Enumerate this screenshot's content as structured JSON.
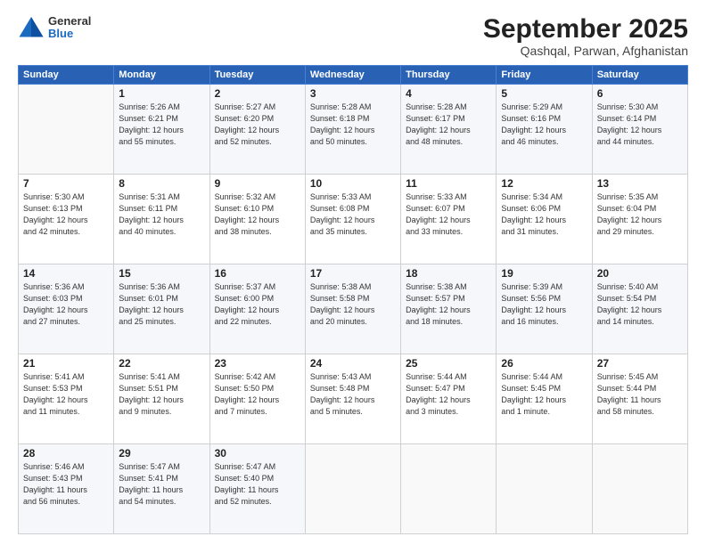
{
  "logo": {
    "general": "General",
    "blue": "Blue"
  },
  "header": {
    "title": "September 2025",
    "subtitle": "Qashqal, Parwan, Afghanistan"
  },
  "weekdays": [
    "Sunday",
    "Monday",
    "Tuesday",
    "Wednesday",
    "Thursday",
    "Friday",
    "Saturday"
  ],
  "weeks": [
    [
      {
        "day": "",
        "info": ""
      },
      {
        "day": "1",
        "info": "Sunrise: 5:26 AM\nSunset: 6:21 PM\nDaylight: 12 hours\nand 55 minutes."
      },
      {
        "day": "2",
        "info": "Sunrise: 5:27 AM\nSunset: 6:20 PM\nDaylight: 12 hours\nand 52 minutes."
      },
      {
        "day": "3",
        "info": "Sunrise: 5:28 AM\nSunset: 6:18 PM\nDaylight: 12 hours\nand 50 minutes."
      },
      {
        "day": "4",
        "info": "Sunrise: 5:28 AM\nSunset: 6:17 PM\nDaylight: 12 hours\nand 48 minutes."
      },
      {
        "day": "5",
        "info": "Sunrise: 5:29 AM\nSunset: 6:16 PM\nDaylight: 12 hours\nand 46 minutes."
      },
      {
        "day": "6",
        "info": "Sunrise: 5:30 AM\nSunset: 6:14 PM\nDaylight: 12 hours\nand 44 minutes."
      }
    ],
    [
      {
        "day": "7",
        "info": "Sunrise: 5:30 AM\nSunset: 6:13 PM\nDaylight: 12 hours\nand 42 minutes."
      },
      {
        "day": "8",
        "info": "Sunrise: 5:31 AM\nSunset: 6:11 PM\nDaylight: 12 hours\nand 40 minutes."
      },
      {
        "day": "9",
        "info": "Sunrise: 5:32 AM\nSunset: 6:10 PM\nDaylight: 12 hours\nand 38 minutes."
      },
      {
        "day": "10",
        "info": "Sunrise: 5:33 AM\nSunset: 6:08 PM\nDaylight: 12 hours\nand 35 minutes."
      },
      {
        "day": "11",
        "info": "Sunrise: 5:33 AM\nSunset: 6:07 PM\nDaylight: 12 hours\nand 33 minutes."
      },
      {
        "day": "12",
        "info": "Sunrise: 5:34 AM\nSunset: 6:06 PM\nDaylight: 12 hours\nand 31 minutes."
      },
      {
        "day": "13",
        "info": "Sunrise: 5:35 AM\nSunset: 6:04 PM\nDaylight: 12 hours\nand 29 minutes."
      }
    ],
    [
      {
        "day": "14",
        "info": "Sunrise: 5:36 AM\nSunset: 6:03 PM\nDaylight: 12 hours\nand 27 minutes."
      },
      {
        "day": "15",
        "info": "Sunrise: 5:36 AM\nSunset: 6:01 PM\nDaylight: 12 hours\nand 25 minutes."
      },
      {
        "day": "16",
        "info": "Sunrise: 5:37 AM\nSunset: 6:00 PM\nDaylight: 12 hours\nand 22 minutes."
      },
      {
        "day": "17",
        "info": "Sunrise: 5:38 AM\nSunset: 5:58 PM\nDaylight: 12 hours\nand 20 minutes."
      },
      {
        "day": "18",
        "info": "Sunrise: 5:38 AM\nSunset: 5:57 PM\nDaylight: 12 hours\nand 18 minutes."
      },
      {
        "day": "19",
        "info": "Sunrise: 5:39 AM\nSunset: 5:56 PM\nDaylight: 12 hours\nand 16 minutes."
      },
      {
        "day": "20",
        "info": "Sunrise: 5:40 AM\nSunset: 5:54 PM\nDaylight: 12 hours\nand 14 minutes."
      }
    ],
    [
      {
        "day": "21",
        "info": "Sunrise: 5:41 AM\nSunset: 5:53 PM\nDaylight: 12 hours\nand 11 minutes."
      },
      {
        "day": "22",
        "info": "Sunrise: 5:41 AM\nSunset: 5:51 PM\nDaylight: 12 hours\nand 9 minutes."
      },
      {
        "day": "23",
        "info": "Sunrise: 5:42 AM\nSunset: 5:50 PM\nDaylight: 12 hours\nand 7 minutes."
      },
      {
        "day": "24",
        "info": "Sunrise: 5:43 AM\nSunset: 5:48 PM\nDaylight: 12 hours\nand 5 minutes."
      },
      {
        "day": "25",
        "info": "Sunrise: 5:44 AM\nSunset: 5:47 PM\nDaylight: 12 hours\nand 3 minutes."
      },
      {
        "day": "26",
        "info": "Sunrise: 5:44 AM\nSunset: 5:45 PM\nDaylight: 12 hours\nand 1 minute."
      },
      {
        "day": "27",
        "info": "Sunrise: 5:45 AM\nSunset: 5:44 PM\nDaylight: 11 hours\nand 58 minutes."
      }
    ],
    [
      {
        "day": "28",
        "info": "Sunrise: 5:46 AM\nSunset: 5:43 PM\nDaylight: 11 hours\nand 56 minutes."
      },
      {
        "day": "29",
        "info": "Sunrise: 5:47 AM\nSunset: 5:41 PM\nDaylight: 11 hours\nand 54 minutes."
      },
      {
        "day": "30",
        "info": "Sunrise: 5:47 AM\nSunset: 5:40 PM\nDaylight: 11 hours\nand 52 minutes."
      },
      {
        "day": "",
        "info": ""
      },
      {
        "day": "",
        "info": ""
      },
      {
        "day": "",
        "info": ""
      },
      {
        "day": "",
        "info": ""
      }
    ]
  ]
}
